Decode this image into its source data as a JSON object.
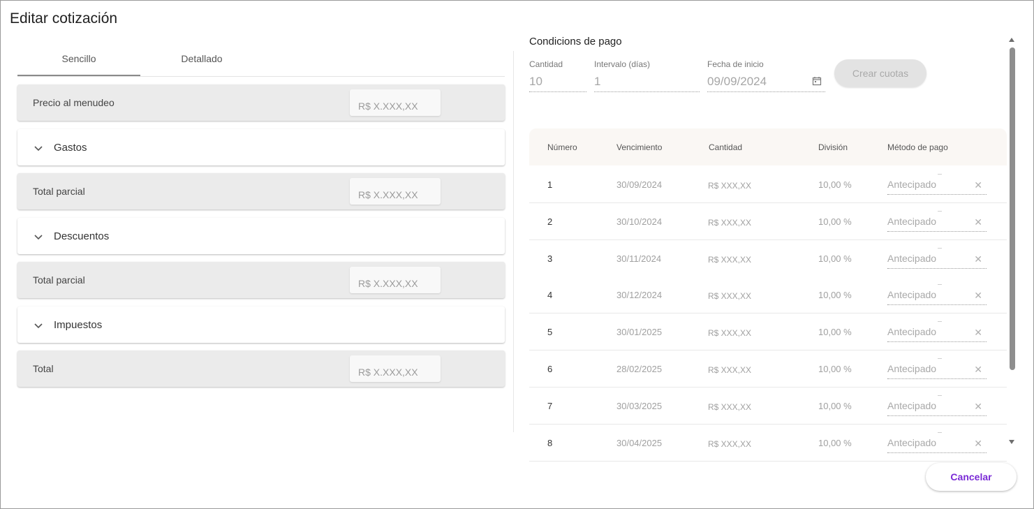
{
  "dialog": {
    "title": "Editar cotización"
  },
  "tabs": [
    {
      "label": "Sencillo",
      "active": true
    },
    {
      "label": "Detallado",
      "active": false
    }
  ],
  "summary": {
    "retail_price": {
      "label": "Precio al menudeo",
      "placeholder": "R$ X.XXX,XX"
    },
    "expenses": {
      "label": "Gastos"
    },
    "subtotal_1": {
      "label": "Total parcial",
      "placeholder": "R$ X.XXX,XX"
    },
    "discounts": {
      "label": "Descuentos"
    },
    "subtotal_2": {
      "label": "Total parcial",
      "placeholder": "R$ X.XXX,XX"
    },
    "taxes": {
      "label": "Impuestos"
    },
    "total": {
      "label": "Total",
      "placeholder": "R$ X.XXX,XX"
    }
  },
  "payment_terms": {
    "title": "Condicions de pago",
    "quantity": {
      "label": "Cantidad",
      "value": "10"
    },
    "interval": {
      "label": "Intervalo (días)",
      "value": "1"
    },
    "start_date": {
      "label": "Fecha de inicio",
      "value": "09/09/2024"
    },
    "create_button": "Crear cuotas",
    "columns": [
      "Número",
      "Vencimiento",
      "Cantidad",
      "División",
      "Método de pago"
    ],
    "installments": [
      {
        "number": "1",
        "due": "30/09/2024",
        "amount": "R$ XXX,XX",
        "split": "10,00 %",
        "method": "Antecipado"
      },
      {
        "number": "2",
        "due": "30/10/2024",
        "amount": "R$ XXX,XX",
        "split": "10,00 %",
        "method": "Antecipado"
      },
      {
        "number": "3",
        "due": "30/11/2024",
        "amount": "R$ XXX,XX",
        "split": "10,00 %",
        "method": "Antecipado"
      },
      {
        "number": "4",
        "due": "30/12/2024",
        "amount": "R$ XXX,XX",
        "split": "10,00 %",
        "method": "Antecipado"
      },
      {
        "number": "5",
        "due": "30/01/2025",
        "amount": "R$ XXX,XX",
        "split": "10,00 %",
        "method": "Antecipado"
      },
      {
        "number": "6",
        "due": "28/02/2025",
        "amount": "R$ XXX,XX",
        "split": "10,00 %",
        "method": "Antecipado"
      },
      {
        "number": "7",
        "due": "30/03/2025",
        "amount": "R$ XXX,XX",
        "split": "10,00 %",
        "method": "Antecipado"
      },
      {
        "number": "8",
        "due": "30/04/2025",
        "amount": "R$ XXX,XX",
        "split": "10,00 %",
        "method": "Antecipado"
      }
    ]
  },
  "footer": {
    "cancel_button": "Cancelar"
  },
  "colors": {
    "accent": "#7a2ad6",
    "header_bg": "#faf7f4",
    "row_bg": "#ebebeb"
  },
  "icons": {
    "accordion": "chevron-down-icon",
    "date": "calendar-icon",
    "clear": "close-icon"
  }
}
